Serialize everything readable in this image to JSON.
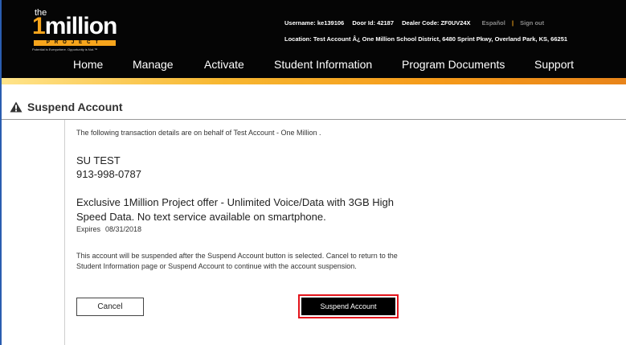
{
  "brand": {
    "logo_the": "the",
    "logo_one": "1",
    "logo_rest": "million",
    "logo_project": "PROJECT",
    "logo_tagline": "Potential is Everywhere. Opportunity is Not.™",
    "accent_color": "#f7a51c"
  },
  "user": {
    "username": "Username: ke139106",
    "door_id": "Door Id: 42187",
    "dealer_code": "Dealer Code: ZF0UV24X",
    "language_link": "Español",
    "pipe": "|",
    "signout_link": "Sign out",
    "location": "Location:  Test Account Â¿ One Million School District,  6480 Sprint Pkwy,  Overland Park,  KS,  66251"
  },
  "nav": {
    "items": [
      "Home",
      "Manage",
      "Activate",
      "Student Information",
      "Program Documents",
      "Support"
    ]
  },
  "page": {
    "title": "Suspend Account",
    "intro": "The following transaction details are on behalf of  Test Account - One Million .",
    "name": "SU TEST",
    "phone": "913-998-0787",
    "offer": "Exclusive 1Million Project offer - Unlimited Voice/Data with 3GB High Speed Data. No text service available on smartphone.",
    "expires_label": "Expires",
    "expires_date": "08/31/2018",
    "notice": "This account will be suspended after the Suspend Account button is selected. Cancel to return to the Student Information page or Suspend Account to continue with the account suspension.",
    "cancel_label": "Cancel",
    "suspend_label": "Suspend Account"
  },
  "icons": {
    "warning": "warning-triangle-icon"
  }
}
